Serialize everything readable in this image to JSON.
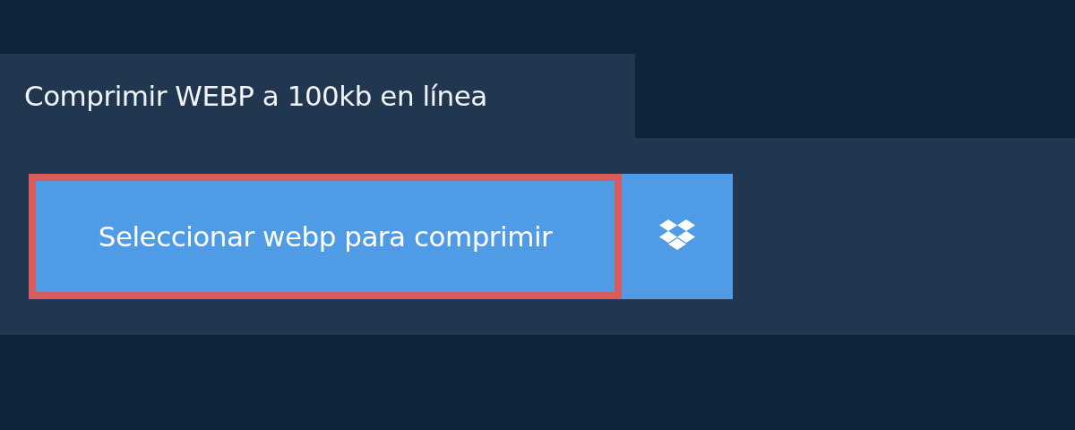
{
  "tab": {
    "title": "Comprimir WEBP a 100kb en línea"
  },
  "upload_button": {
    "label": "Seleccionar webp para comprimir"
  }
}
